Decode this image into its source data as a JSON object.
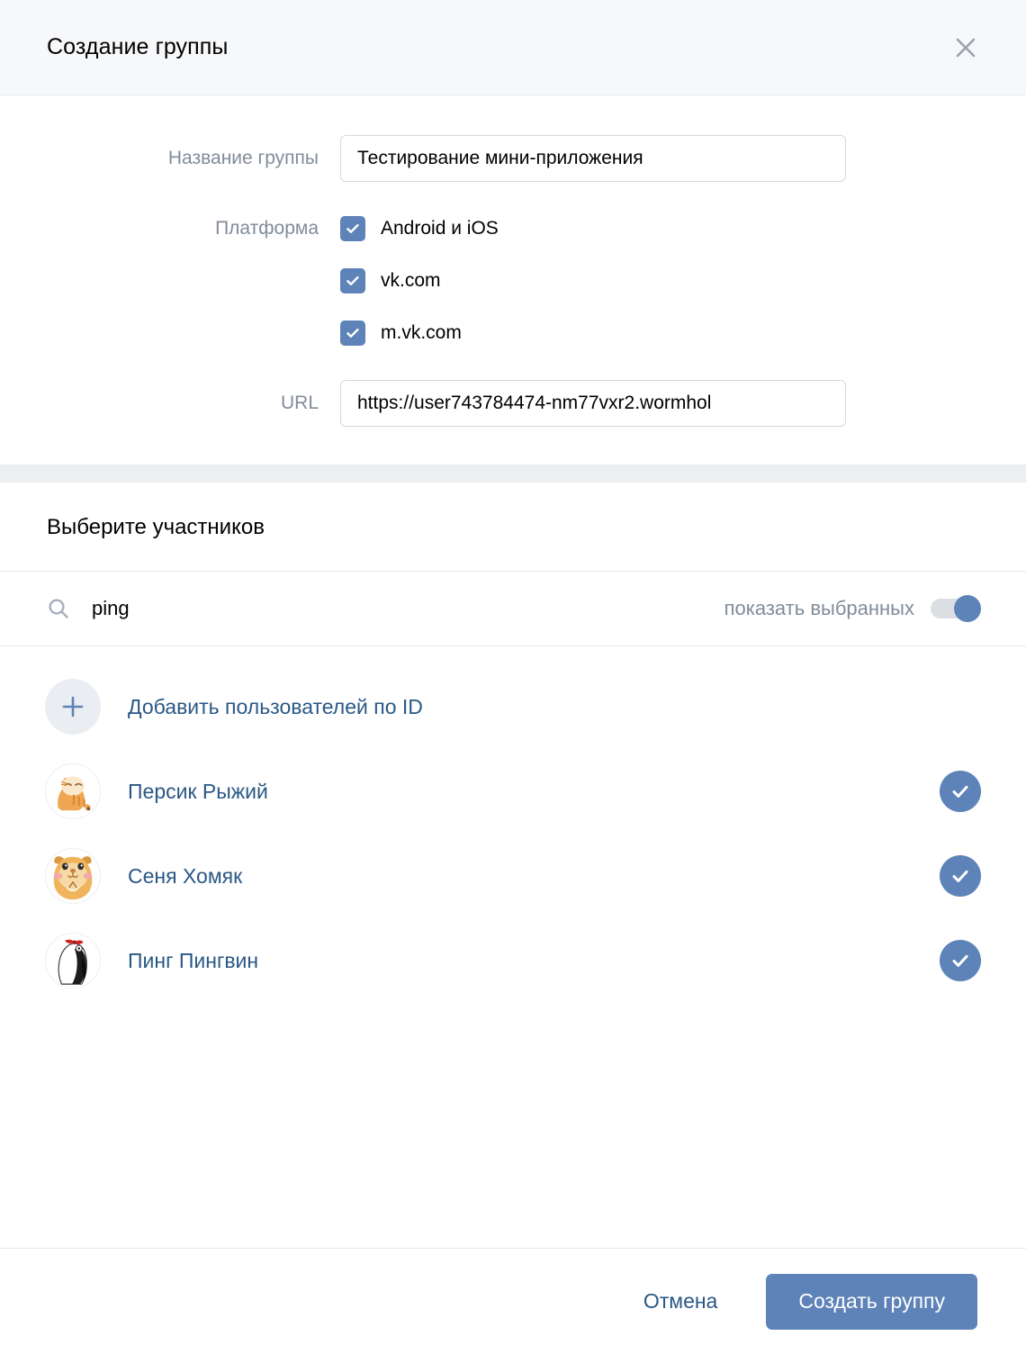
{
  "header": {
    "title": "Создание группы",
    "close_icon": "close-icon"
  },
  "form": {
    "group_name": {
      "label": "Название группы",
      "value": "Тестирование мини-приложения",
      "placeholder": "Название группы"
    },
    "platform": {
      "label": "Платформа",
      "options": [
        {
          "label": "Android и iOS",
          "checked": true
        },
        {
          "label": "vk.com",
          "checked": true
        },
        {
          "label": "m.vk.com",
          "checked": true
        }
      ]
    },
    "url": {
      "label": "URL",
      "value": "https://user743784474-nm77vxr2.wormhol",
      "placeholder": "URL"
    }
  },
  "members": {
    "title": "Выберите участников",
    "search": {
      "value": "ping",
      "placeholder": "Поиск",
      "icon": "search-icon"
    },
    "toggle": {
      "label": "показать выбранных",
      "state": "on"
    },
    "add_by_id": {
      "label": "Добавить пользователей по ID",
      "icon": "plus-icon"
    },
    "list": [
      {
        "name": "Персик Рыжий",
        "avatar": "cat-avatar",
        "selected": true
      },
      {
        "name": "Сеня Хомяк",
        "avatar": "hamster-avatar",
        "selected": true
      },
      {
        "name": "Пинг Пингвин",
        "avatar": "penguin-avatar",
        "selected": true
      }
    ]
  },
  "footer": {
    "cancel_label": "Отмена",
    "submit_label": "Создать группу"
  },
  "colors": {
    "accent": "#5e83b8",
    "link": "#2a5885",
    "muted": "#818c99",
    "band": "#edeef0",
    "header_bg": "#f7f8fa"
  }
}
